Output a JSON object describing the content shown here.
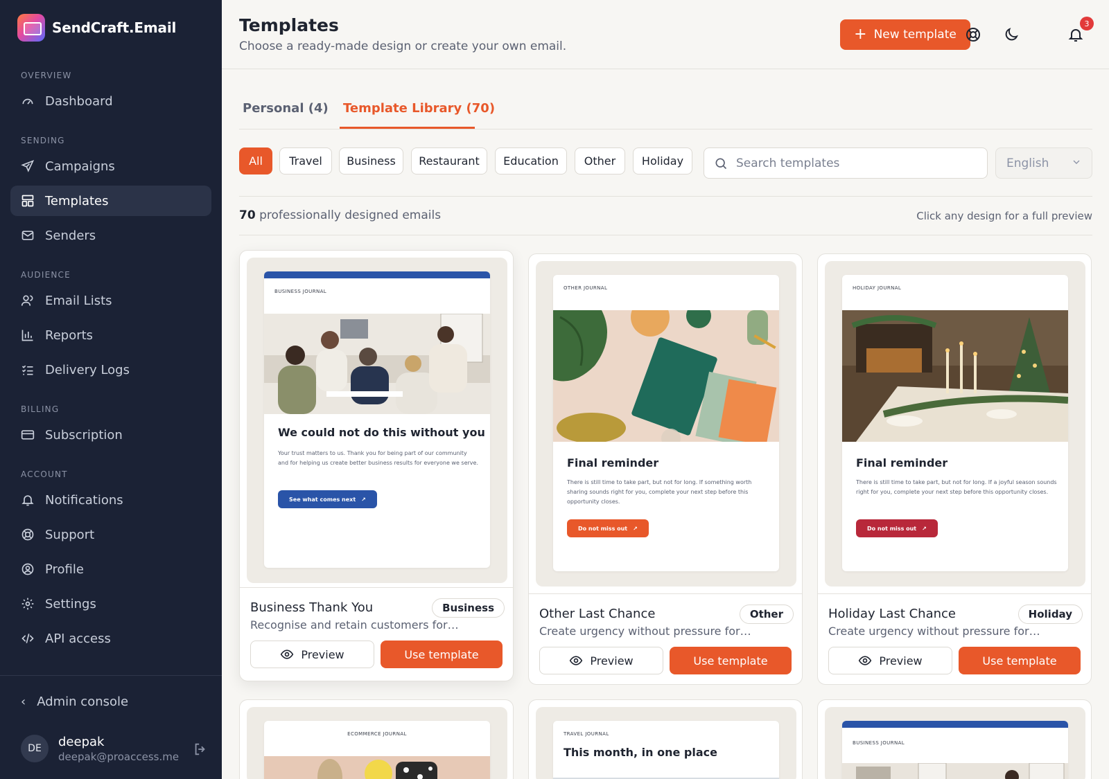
{
  "brand": {
    "name": "SendCraft.Email"
  },
  "sidebar": {
    "sections": {
      "overview": "OVERVIEW",
      "sending": "SENDING",
      "audience": "AUDIENCE",
      "billing": "BILLING",
      "account": "ACCOUNT"
    },
    "items": {
      "dashboard": "Dashboard",
      "campaigns": "Campaigns",
      "templates": "Templates",
      "senders": "Senders",
      "email_lists": "Email Lists",
      "reports": "Reports",
      "delivery_logs": "Delivery Logs",
      "subscription": "Subscription",
      "notifications": "Notifications",
      "support": "Support",
      "profile": "Profile",
      "settings": "Settings",
      "api_access": "API access"
    },
    "active_item": "templates",
    "admin_console": "Admin console",
    "user": {
      "initials": "DE",
      "name": "deepak",
      "email": "deepak@proaccess.me"
    }
  },
  "header": {
    "title": "Templates",
    "subtitle": "Choose a ready-made design or create your own email.",
    "new_template_label": "New template",
    "notification_count": "3"
  },
  "tabs": [
    {
      "label": "Personal (4)",
      "active": false
    },
    {
      "label": "Template Library (70)",
      "active": true
    }
  ],
  "filters": {
    "chips": [
      "All",
      "Travel",
      "Business",
      "Restaurant",
      "Education",
      "Other",
      "Holiday"
    ],
    "active": "All",
    "search_placeholder": "Search templates",
    "language": "English"
  },
  "summary": {
    "count": "70",
    "count_suffix": "professionally designed emails",
    "hint": "Click any design for a full preview"
  },
  "colors": {
    "accent": "#e8582a",
    "sidebar_bg": "#1b2235",
    "business_blue": "#2a54a8",
    "holiday_red": "#b8283a"
  },
  "cards": [
    {
      "journal": "BUSINESS JOURNAL",
      "email_title": "We could not do this without you",
      "email_body": "Your trust matters to us. Thank you for being part of our community and for helping us create better business results for everyone we serve.",
      "email_button": "See what comes next",
      "name": "Business Thank You",
      "description": "Recognise and retain customers for…",
      "tag": "Business",
      "preview_label": "Preview",
      "use_label": "Use template"
    },
    {
      "journal": "OTHER JOURNAL",
      "email_title": "Final reminder",
      "email_body": "There is still time to take part, but not for long. If something worth sharing sounds right for you, complete your next step before this opportunity closes.",
      "email_button": "Do not miss out",
      "name": "Other Last Chance",
      "description": "Create urgency without pressure for…",
      "tag": "Other",
      "preview_label": "Preview",
      "use_label": "Use template"
    },
    {
      "journal": "HOLIDAY JOURNAL",
      "email_title": "Final reminder",
      "email_body": "There is still time to take part, but not for long. If a joyful season sounds right for you, complete your next step before this opportunity closes.",
      "email_button": "Do not miss out",
      "name": "Holiday Last Chance",
      "description": "Create urgency without pressure for…",
      "tag": "Holiday",
      "preview_label": "Preview",
      "use_label": "Use template"
    },
    {
      "journal": "ECOMMERCE JOURNAL"
    },
    {
      "journal": "TRAVEL JOURNAL",
      "email_title": "This month, in one place"
    },
    {
      "journal": "BUSINESS JOURNAL"
    }
  ]
}
